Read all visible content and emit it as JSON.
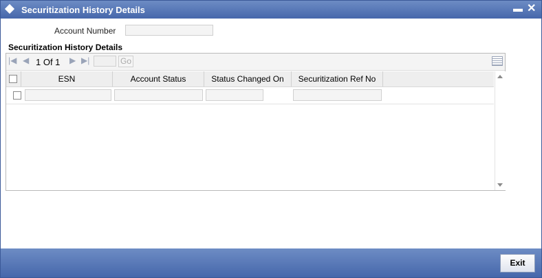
{
  "window": {
    "title": "Securitization History Details"
  },
  "form": {
    "account_number_label": "Account Number",
    "account_number_value": ""
  },
  "section": {
    "title": "Securitization History Details"
  },
  "pager": {
    "text": "1 Of 1",
    "page_input": "",
    "go_label": "Go"
  },
  "table": {
    "columns": [
      "ESN",
      "Account Status",
      "Status Changed On",
      "Securitization Ref No"
    ],
    "rows": [
      [
        "",
        "",
        "",
        ""
      ]
    ]
  },
  "footer": {
    "exit_label": "Exit"
  },
  "colors": {
    "title_bar": "#4a6aae",
    "footer": "#4a6aae",
    "header_bg": "#eeeeee",
    "input_bg": "#f4f4f4"
  },
  "icons": {
    "title": "diamond-icon",
    "minimize": "minimize-icon",
    "close": "close-icon",
    "first": "first-page-icon",
    "prev": "prev-page-icon",
    "next": "next-page-icon",
    "last": "last-page-icon",
    "grid_menu": "grid-menu-icon"
  }
}
